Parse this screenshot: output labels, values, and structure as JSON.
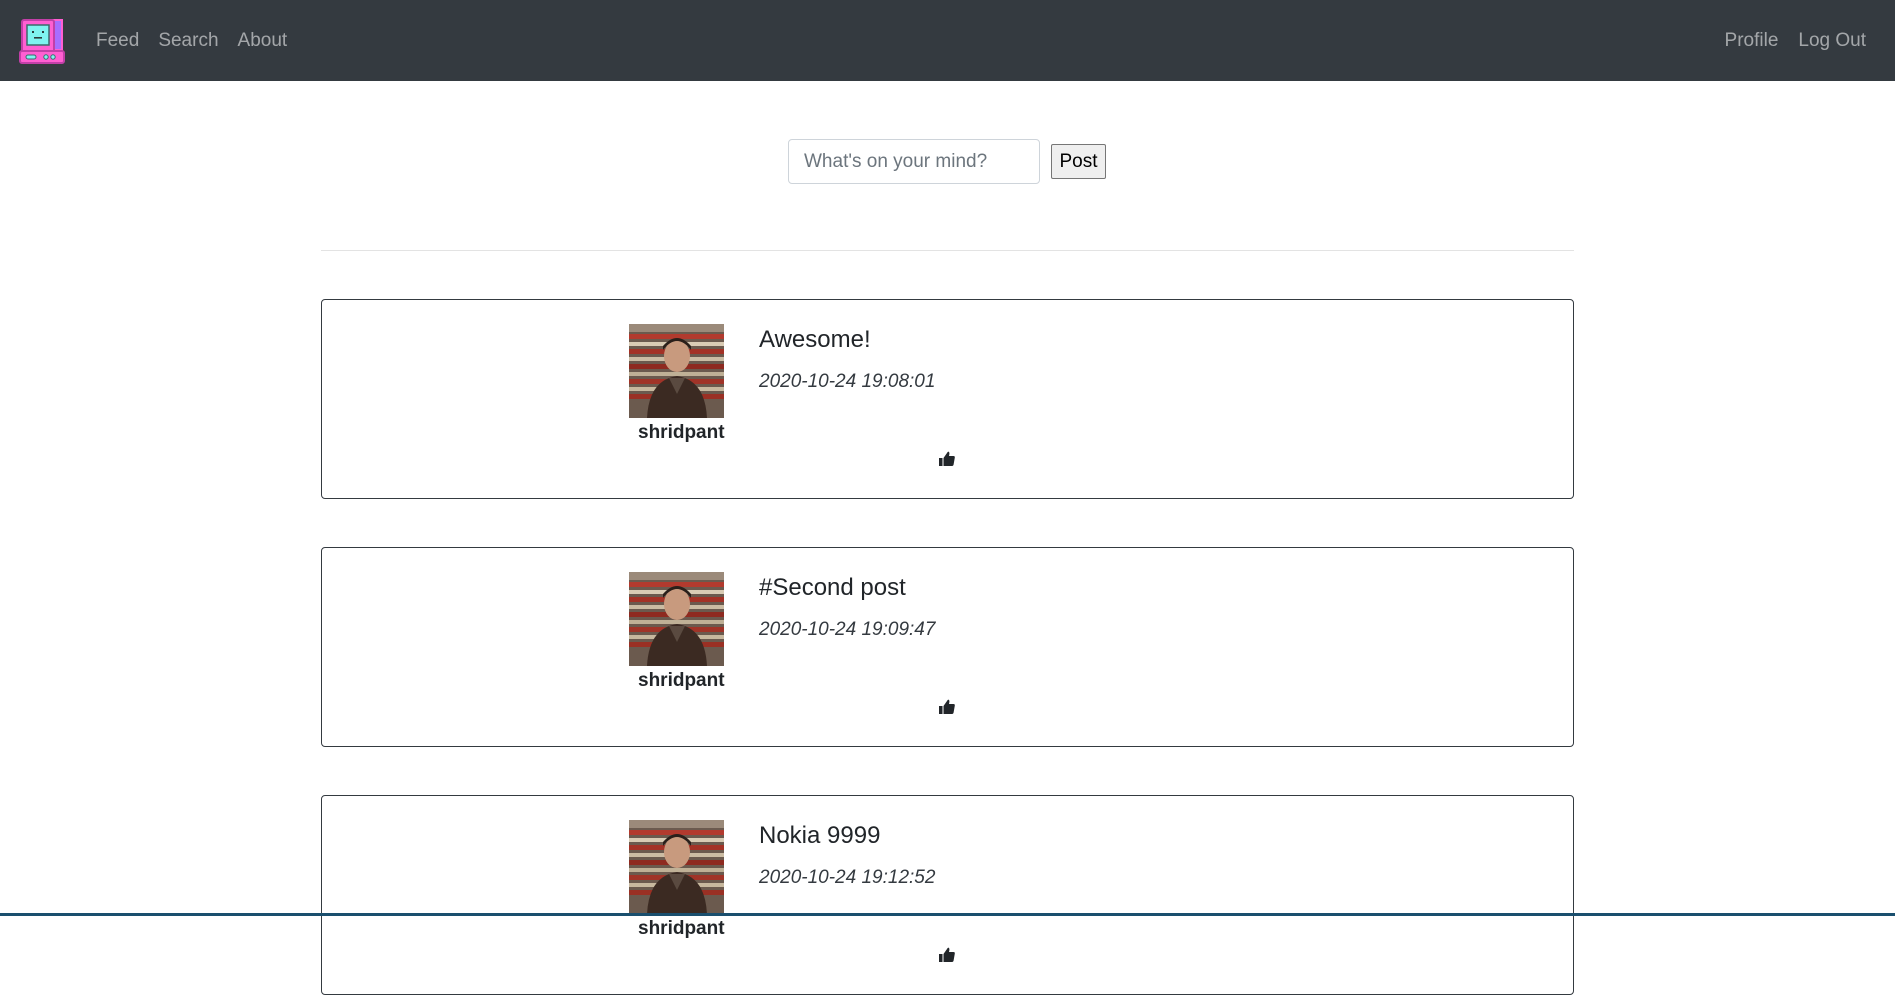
{
  "nav": {
    "brand_icon": "retro-computer-logo-icon",
    "left_links": [
      "Feed",
      "Search",
      "About"
    ],
    "right_links": [
      "Profile",
      "Log Out"
    ]
  },
  "composer": {
    "placeholder": "What's on your mind?",
    "value": "",
    "post_label": "Post"
  },
  "posts": [
    {
      "username": "shridpant",
      "title": "Awesome!",
      "time": "2020-10-24 19:08:01",
      "like_icon": "thumbs-up-icon"
    },
    {
      "username": "shridpant",
      "title": "#Second post",
      "time": "2020-10-24 19:09:47",
      "like_icon": "thumbs-up-icon"
    },
    {
      "username": "shridpant",
      "title": "Nokia 9999",
      "time": "2020-10-24 19:12:52",
      "like_icon": "thumbs-up-icon"
    }
  ],
  "colors": {
    "navbar": "#343a40",
    "nav_link": "rgba(255,255,255,0.55)",
    "brand_pink": "#ff5fd2",
    "brand_cyan": "#7ff3f0",
    "brand_purple": "#a86dff"
  }
}
